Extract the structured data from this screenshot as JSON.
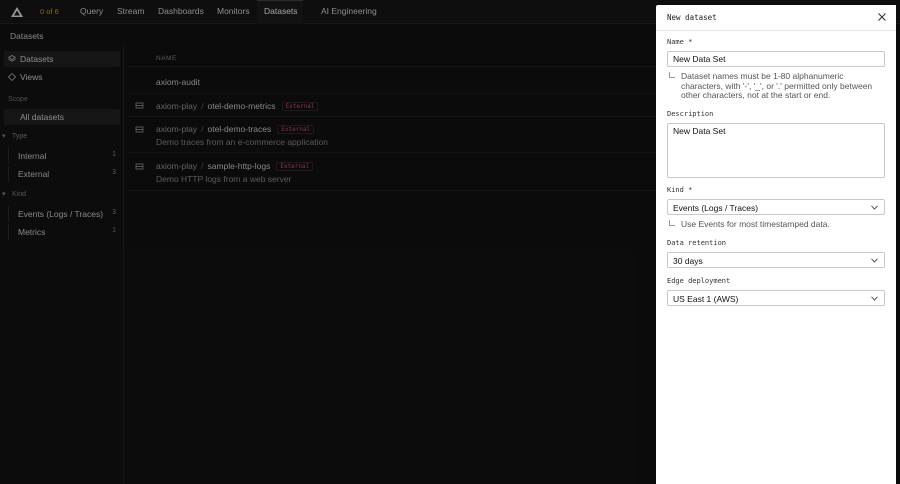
{
  "nav": {
    "counter": "0 of 6",
    "items": [
      "Query",
      "Stream",
      "Dashboards",
      "Monitors",
      "Datasets",
      "AI Engineering"
    ],
    "active": "Datasets"
  },
  "breadcrumb": "Datasets",
  "sidebar": {
    "items": [
      {
        "label": "Datasets",
        "icon": "layers-icon",
        "selected": true
      },
      {
        "label": "Views",
        "icon": "diamond-icon",
        "selected": false
      }
    ],
    "scope_label": "Scope",
    "scope_item": "All datasets",
    "groups": [
      {
        "label": "Type",
        "facets": [
          {
            "label": "Internal",
            "count": "1"
          },
          {
            "label": "External",
            "count": "3"
          }
        ]
      },
      {
        "label": "Kind",
        "facets": [
          {
            "label": "Events (Logs / Traces)",
            "count": "3"
          },
          {
            "label": "Metrics",
            "count": "1"
          }
        ]
      }
    ]
  },
  "list": {
    "column_header": "NAME",
    "rows": [
      {
        "org": "",
        "name": "axiom-audit",
        "badge": "",
        "desc": ""
      },
      {
        "org": "axiom-play",
        "name": "otel-demo-metrics",
        "badge": "External",
        "desc": ""
      },
      {
        "org": "axiom-play",
        "name": "otel-demo-traces",
        "badge": "External",
        "desc": "Demo traces from an e-commerce application"
      },
      {
        "org": "axiom-play",
        "name": "sample-http-logs",
        "badge": "External",
        "desc": "Demo HTTP logs from a web server"
      }
    ]
  },
  "modal": {
    "title": "New dataset",
    "name_label": "Name *",
    "name_value": "New Data Set",
    "name_hint": "Dataset names must be 1-80 alphanumeric characters, with '-', '_', or '.' permitted only between other characters, not at the start or end.",
    "description_label": "Description",
    "description_value": "New Data Set",
    "kind_label": "Kind *",
    "kind_value": "Events (Logs / Traces)",
    "kind_hint": "Use Events for most timestamped data.",
    "retention_label": "Data retention",
    "retention_value": "30 days",
    "edge_label": "Edge deployment",
    "edge_value": "US East 1 (AWS)"
  }
}
